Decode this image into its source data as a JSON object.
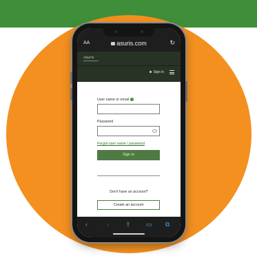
{
  "browser": {
    "text_size_label": "AA",
    "url": "asuris.com",
    "reload_icon": "reload-icon"
  },
  "site": {
    "logo_text": "Asuris",
    "signin_link": "Sign in",
    "menu_icon": "hamburger-menu-icon"
  },
  "login_form": {
    "username_label": "User name or email",
    "username_value": "",
    "password_label": "Password",
    "password_value": "",
    "forgot_link": "Forgot user name / password",
    "signin_button": "Sign in",
    "no_account_text": "Don't have an account?",
    "create_account_button": "Create an account"
  },
  "toolbar": {
    "icons": [
      "back-icon",
      "forward-icon",
      "share-icon",
      "bookmarks-icon",
      "tabs-icon"
    ]
  },
  "colors": {
    "brand_green": "#3f8f3a",
    "orange": "#f39020",
    "button_green": "#4f7a44",
    "header_dark": "#283326"
  }
}
